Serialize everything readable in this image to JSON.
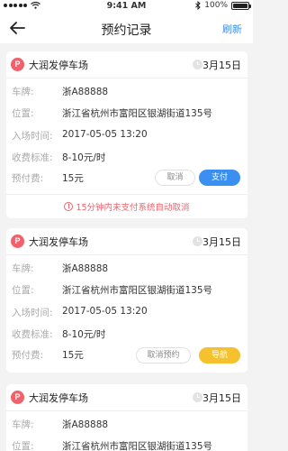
{
  "status_bar": {
    "time": "9:41 AM",
    "battery": "100%"
  },
  "nav": {
    "title": "预约记录",
    "refresh": "刷新"
  },
  "labels": {
    "plate": "车牌:",
    "location": "位置:",
    "entry_time": "入场时间:",
    "fee_rate": "收费标准:",
    "prepaid": "预付费:"
  },
  "records": [
    {
      "lot_name": "大润发停车场",
      "date": "3月15日",
      "plate": "浙A88888",
      "location": "浙江省杭州市富阳区银湖街道135号",
      "entry_time": "2017-05-05 13:20",
      "fee_rate": "8-10元/时",
      "prepaid": "15元",
      "buttons": {
        "cancel": "取消",
        "pay": "支付"
      },
      "warning": "15分钟内未支付系统自动取消"
    },
    {
      "lot_name": "大润发停车场",
      "date": "3月15日",
      "plate": "浙A88888",
      "location": "浙江省杭州市富阳区银湖街道135号",
      "entry_time": "2017-05-05 13:20",
      "fee_rate": "8-10元/时",
      "prepaid": "15元",
      "buttons": {
        "cancel_reservation": "取消预约",
        "navigate": "导航"
      }
    },
    {
      "lot_name": "大润发停车场",
      "date": "3月15日",
      "plate": "浙A88888",
      "location": "浙江省杭州市富阳区银湖街道135号"
    }
  ],
  "colors": {
    "accent": "#3b8ff0",
    "warning": "#f0616b",
    "navigate": "#f6c12e",
    "parking_icon": "#f0616b"
  }
}
